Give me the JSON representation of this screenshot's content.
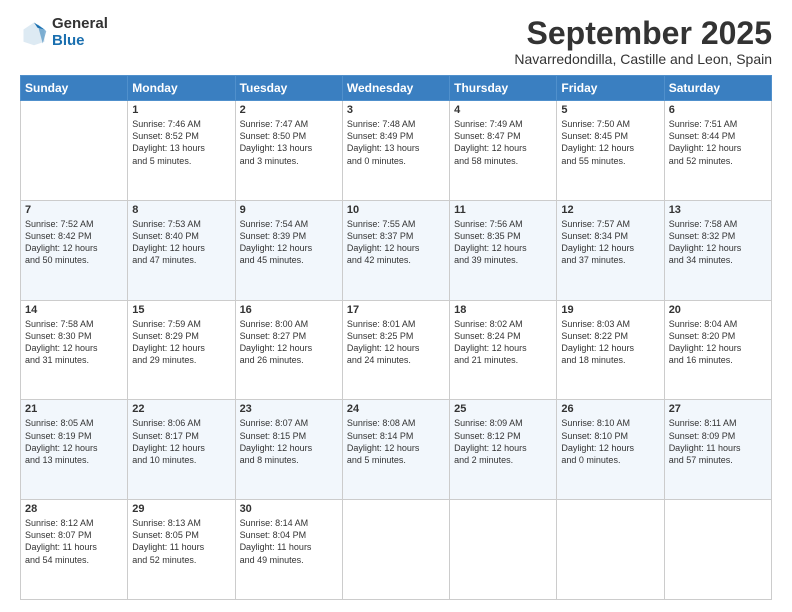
{
  "logo": {
    "general": "General",
    "blue": "Blue"
  },
  "title": "September 2025",
  "location": "Navarredondilla, Castille and Leon, Spain",
  "weekdays": [
    "Sunday",
    "Monday",
    "Tuesday",
    "Wednesday",
    "Thursday",
    "Friday",
    "Saturday"
  ],
  "weeks": [
    [
      {
        "day": "",
        "content": ""
      },
      {
        "day": "1",
        "content": "Sunrise: 7:46 AM\nSunset: 8:52 PM\nDaylight: 13 hours\nand 5 minutes."
      },
      {
        "day": "2",
        "content": "Sunrise: 7:47 AM\nSunset: 8:50 PM\nDaylight: 13 hours\nand 3 minutes."
      },
      {
        "day": "3",
        "content": "Sunrise: 7:48 AM\nSunset: 8:49 PM\nDaylight: 13 hours\nand 0 minutes."
      },
      {
        "day": "4",
        "content": "Sunrise: 7:49 AM\nSunset: 8:47 PM\nDaylight: 12 hours\nand 58 minutes."
      },
      {
        "day": "5",
        "content": "Sunrise: 7:50 AM\nSunset: 8:45 PM\nDaylight: 12 hours\nand 55 minutes."
      },
      {
        "day": "6",
        "content": "Sunrise: 7:51 AM\nSunset: 8:44 PM\nDaylight: 12 hours\nand 52 minutes."
      }
    ],
    [
      {
        "day": "7",
        "content": "Sunrise: 7:52 AM\nSunset: 8:42 PM\nDaylight: 12 hours\nand 50 minutes."
      },
      {
        "day": "8",
        "content": "Sunrise: 7:53 AM\nSunset: 8:40 PM\nDaylight: 12 hours\nand 47 minutes."
      },
      {
        "day": "9",
        "content": "Sunrise: 7:54 AM\nSunset: 8:39 PM\nDaylight: 12 hours\nand 45 minutes."
      },
      {
        "day": "10",
        "content": "Sunrise: 7:55 AM\nSunset: 8:37 PM\nDaylight: 12 hours\nand 42 minutes."
      },
      {
        "day": "11",
        "content": "Sunrise: 7:56 AM\nSunset: 8:35 PM\nDaylight: 12 hours\nand 39 minutes."
      },
      {
        "day": "12",
        "content": "Sunrise: 7:57 AM\nSunset: 8:34 PM\nDaylight: 12 hours\nand 37 minutes."
      },
      {
        "day": "13",
        "content": "Sunrise: 7:58 AM\nSunset: 8:32 PM\nDaylight: 12 hours\nand 34 minutes."
      }
    ],
    [
      {
        "day": "14",
        "content": "Sunrise: 7:58 AM\nSunset: 8:30 PM\nDaylight: 12 hours\nand 31 minutes."
      },
      {
        "day": "15",
        "content": "Sunrise: 7:59 AM\nSunset: 8:29 PM\nDaylight: 12 hours\nand 29 minutes."
      },
      {
        "day": "16",
        "content": "Sunrise: 8:00 AM\nSunset: 8:27 PM\nDaylight: 12 hours\nand 26 minutes."
      },
      {
        "day": "17",
        "content": "Sunrise: 8:01 AM\nSunset: 8:25 PM\nDaylight: 12 hours\nand 24 minutes."
      },
      {
        "day": "18",
        "content": "Sunrise: 8:02 AM\nSunset: 8:24 PM\nDaylight: 12 hours\nand 21 minutes."
      },
      {
        "day": "19",
        "content": "Sunrise: 8:03 AM\nSunset: 8:22 PM\nDaylight: 12 hours\nand 18 minutes."
      },
      {
        "day": "20",
        "content": "Sunrise: 8:04 AM\nSunset: 8:20 PM\nDaylight: 12 hours\nand 16 minutes."
      }
    ],
    [
      {
        "day": "21",
        "content": "Sunrise: 8:05 AM\nSunset: 8:19 PM\nDaylight: 12 hours\nand 13 minutes."
      },
      {
        "day": "22",
        "content": "Sunrise: 8:06 AM\nSunset: 8:17 PM\nDaylight: 12 hours\nand 10 minutes."
      },
      {
        "day": "23",
        "content": "Sunrise: 8:07 AM\nSunset: 8:15 PM\nDaylight: 12 hours\nand 8 minutes."
      },
      {
        "day": "24",
        "content": "Sunrise: 8:08 AM\nSunset: 8:14 PM\nDaylight: 12 hours\nand 5 minutes."
      },
      {
        "day": "25",
        "content": "Sunrise: 8:09 AM\nSunset: 8:12 PM\nDaylight: 12 hours\nand 2 minutes."
      },
      {
        "day": "26",
        "content": "Sunrise: 8:10 AM\nSunset: 8:10 PM\nDaylight: 12 hours\nand 0 minutes."
      },
      {
        "day": "27",
        "content": "Sunrise: 8:11 AM\nSunset: 8:09 PM\nDaylight: 11 hours\nand 57 minutes."
      }
    ],
    [
      {
        "day": "28",
        "content": "Sunrise: 8:12 AM\nSunset: 8:07 PM\nDaylight: 11 hours\nand 54 minutes."
      },
      {
        "day": "29",
        "content": "Sunrise: 8:13 AM\nSunset: 8:05 PM\nDaylight: 11 hours\nand 52 minutes."
      },
      {
        "day": "30",
        "content": "Sunrise: 8:14 AM\nSunset: 8:04 PM\nDaylight: 11 hours\nand 49 minutes."
      },
      {
        "day": "",
        "content": ""
      },
      {
        "day": "",
        "content": ""
      },
      {
        "day": "",
        "content": ""
      },
      {
        "day": "",
        "content": ""
      }
    ]
  ]
}
